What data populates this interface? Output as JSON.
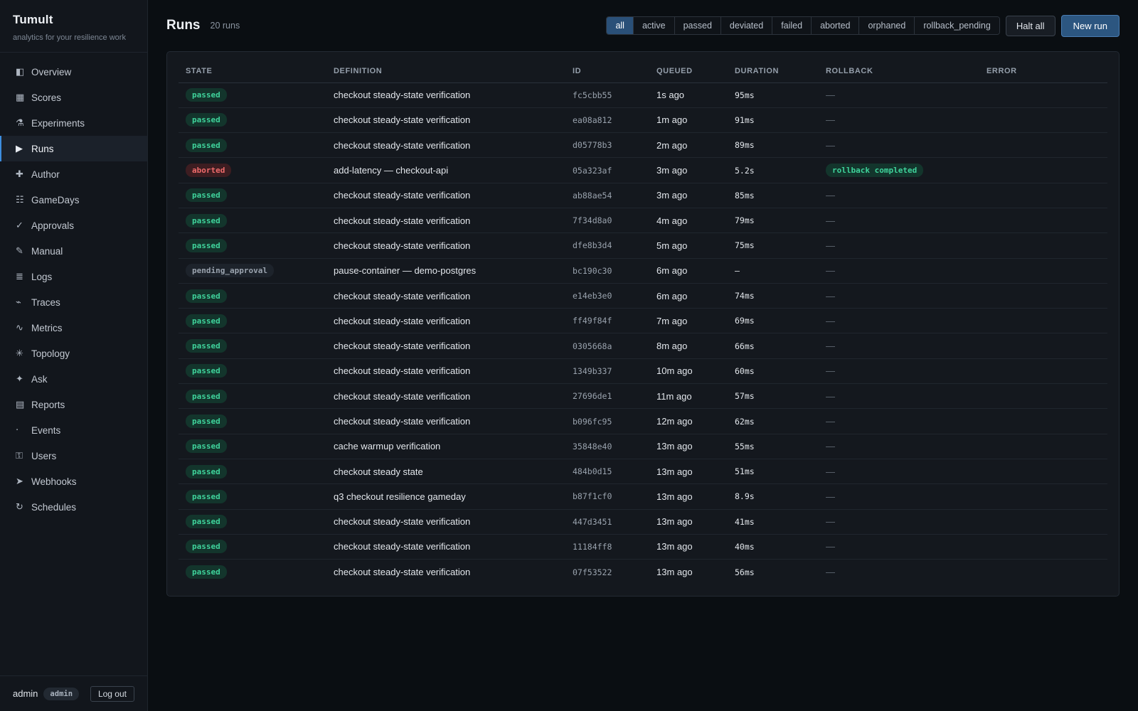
{
  "brand": {
    "title": "Tumult",
    "subtitle": "analytics for your resilience work"
  },
  "nav": [
    {
      "label": "Overview",
      "icon": "◧",
      "name": "overview"
    },
    {
      "label": "Scores",
      "icon": "▦",
      "name": "scores"
    },
    {
      "label": "Experiments",
      "icon": "⚗",
      "name": "experiments"
    },
    {
      "label": "Runs",
      "icon": "▶",
      "name": "runs",
      "active": true
    },
    {
      "label": "Author",
      "icon": "✚",
      "name": "author"
    },
    {
      "label": "GameDays",
      "icon": "☷",
      "name": "gamedays"
    },
    {
      "label": "Approvals",
      "icon": "✓",
      "name": "approvals"
    },
    {
      "label": "Manual",
      "icon": "✎",
      "name": "manual"
    },
    {
      "label": "Logs",
      "icon": "≣",
      "name": "logs"
    },
    {
      "label": "Traces",
      "icon": "⌁",
      "name": "traces"
    },
    {
      "label": "Metrics",
      "icon": "∿",
      "name": "metrics"
    },
    {
      "label": "Topology",
      "icon": "✳",
      "name": "topology"
    },
    {
      "label": "Ask",
      "icon": "✦",
      "name": "ask"
    },
    {
      "label": "Reports",
      "icon": "▤",
      "name": "reports"
    },
    {
      "label": "Events",
      "icon": "‧",
      "name": "events"
    },
    {
      "label": "Users",
      "icon": "⚿",
      "name": "users"
    },
    {
      "label": "Webhooks",
      "icon": "➤",
      "name": "webhooks"
    },
    {
      "label": "Schedules",
      "icon": "↻",
      "name": "schedules"
    }
  ],
  "footer": {
    "user": "admin",
    "role": "admin",
    "logout_label": "Log out"
  },
  "header": {
    "title": "Runs",
    "count": "20 runs",
    "halt_label": "Halt all",
    "new_label": "New run"
  },
  "filters": [
    {
      "label": "all",
      "active": true
    },
    {
      "label": "active"
    },
    {
      "label": "passed"
    },
    {
      "label": "deviated"
    },
    {
      "label": "failed"
    },
    {
      "label": "aborted"
    },
    {
      "label": "orphaned"
    },
    {
      "label": "rollback_pending"
    }
  ],
  "table": {
    "columns": [
      "STATE",
      "DEFINITION",
      "ID",
      "QUEUED",
      "DURATION",
      "ROLLBACK",
      "ERROR"
    ],
    "rows": [
      {
        "state": "passed",
        "definition": "checkout steady-state verification",
        "id": "fc5cbb55",
        "queued": "1s ago",
        "duration": "95ms",
        "rollback": "—",
        "error": ""
      },
      {
        "state": "passed",
        "definition": "checkout steady-state verification",
        "id": "ea08a812",
        "queued": "1m ago",
        "duration": "91ms",
        "rollback": "—",
        "error": ""
      },
      {
        "state": "passed",
        "definition": "checkout steady-state verification",
        "id": "d05778b3",
        "queued": "2m ago",
        "duration": "89ms",
        "rollback": "—",
        "error": ""
      },
      {
        "state": "aborted",
        "definition": "add-latency — checkout-api",
        "id": "05a323af",
        "queued": "3m ago",
        "duration": "5.2s",
        "rollback": "rollback completed",
        "error": ""
      },
      {
        "state": "passed",
        "definition": "checkout steady-state verification",
        "id": "ab88ae54",
        "queued": "3m ago",
        "duration": "85ms",
        "rollback": "—",
        "error": ""
      },
      {
        "state": "passed",
        "definition": "checkout steady-state verification",
        "id": "7f34d8a0",
        "queued": "4m ago",
        "duration": "79ms",
        "rollback": "—",
        "error": ""
      },
      {
        "state": "passed",
        "definition": "checkout steady-state verification",
        "id": "dfe8b3d4",
        "queued": "5m ago",
        "duration": "75ms",
        "rollback": "—",
        "error": ""
      },
      {
        "state": "pending_approval",
        "definition": "pause-container — demo-postgres",
        "id": "bc190c30",
        "queued": "6m ago",
        "duration": "–",
        "rollback": "—",
        "error": ""
      },
      {
        "state": "passed",
        "definition": "checkout steady-state verification",
        "id": "e14eb3e0",
        "queued": "6m ago",
        "duration": "74ms",
        "rollback": "—",
        "error": ""
      },
      {
        "state": "passed",
        "definition": "checkout steady-state verification",
        "id": "ff49f84f",
        "queued": "7m ago",
        "duration": "69ms",
        "rollback": "—",
        "error": ""
      },
      {
        "state": "passed",
        "definition": "checkout steady-state verification",
        "id": "0305668a",
        "queued": "8m ago",
        "duration": "66ms",
        "rollback": "—",
        "error": ""
      },
      {
        "state": "passed",
        "definition": "checkout steady-state verification",
        "id": "1349b337",
        "queued": "10m ago",
        "duration": "60ms",
        "rollback": "—",
        "error": ""
      },
      {
        "state": "passed",
        "definition": "checkout steady-state verification",
        "id": "27696de1",
        "queued": "11m ago",
        "duration": "57ms",
        "rollback": "—",
        "error": ""
      },
      {
        "state": "passed",
        "definition": "checkout steady-state verification",
        "id": "b096fc95",
        "queued": "12m ago",
        "duration": "62ms",
        "rollback": "—",
        "error": ""
      },
      {
        "state": "passed",
        "definition": "cache warmup verification",
        "id": "35848e40",
        "queued": "13m ago",
        "duration": "55ms",
        "rollback": "—",
        "error": ""
      },
      {
        "state": "passed",
        "definition": "checkout steady state",
        "id": "484b0d15",
        "queued": "13m ago",
        "duration": "51ms",
        "rollback": "—",
        "error": ""
      },
      {
        "state": "passed",
        "definition": "q3 checkout resilience gameday",
        "id": "b87f1cf0",
        "queued": "13m ago",
        "duration": "8.9s",
        "rollback": "—",
        "error": ""
      },
      {
        "state": "passed",
        "definition": "checkout steady-state verification",
        "id": "447d3451",
        "queued": "13m ago",
        "duration": "41ms",
        "rollback": "—",
        "error": ""
      },
      {
        "state": "passed",
        "definition": "checkout steady-state verification",
        "id": "11184ff8",
        "queued": "13m ago",
        "duration": "40ms",
        "rollback": "—",
        "error": ""
      },
      {
        "state": "passed",
        "definition": "checkout steady-state verification",
        "id": "07f53522",
        "queued": "13m ago",
        "duration": "56ms",
        "rollback": "—",
        "error": ""
      }
    ]
  }
}
